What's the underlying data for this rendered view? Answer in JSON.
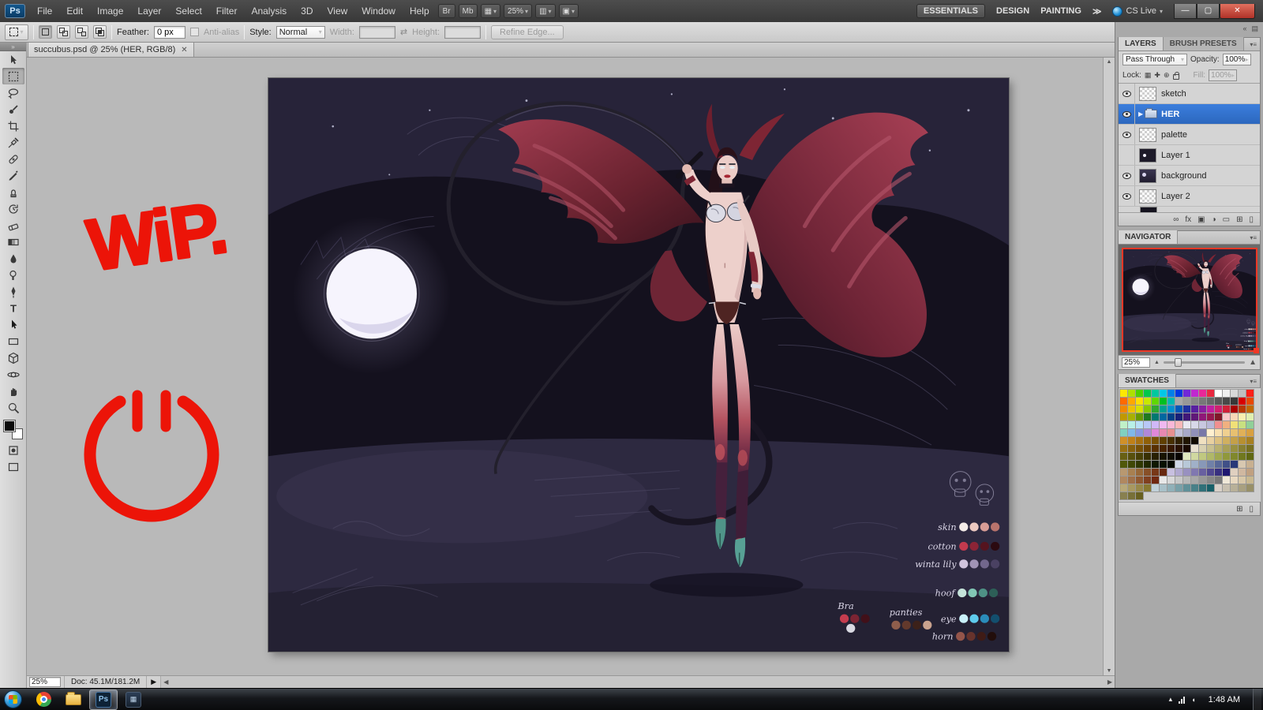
{
  "colors": {
    "selection_blue": "#3b7edd",
    "view_red": "#f03826",
    "wip_red": "#ec1408",
    "close_red": "#c0392b"
  },
  "menu_bar": {
    "logo": "Ps",
    "items": [
      "File",
      "Edit",
      "Image",
      "Layer",
      "Select",
      "Filter",
      "Analysis",
      "3D",
      "View",
      "Window",
      "Help"
    ],
    "bridge_button": "Br",
    "minibridge_button": "Mb",
    "zoom_level": "25%",
    "workspaces": [
      "ESSENTIALS",
      "DESIGN",
      "PAINTING"
    ],
    "cs_live": "CS Live"
  },
  "options_bar": {
    "feather_label": "Feather:",
    "feather_value": "0 px",
    "antialias_label": "Anti-alias",
    "style_label": "Style:",
    "style_value": "Normal",
    "width_label": "Width:",
    "height_label": "Height:",
    "refine_edge_label": "Refine Edge..."
  },
  "document": {
    "tab_title": "succubus.psd @ 25% (HER, RGB/8)",
    "status_zoom": "25%",
    "status_doc": "Doc: 45.1M/181.2M"
  },
  "artwork": {
    "wip_text": "WiP.",
    "palette": [
      {
        "label": "skin",
        "colors": [
          "#f4ece8",
          "#ecc9c1",
          "#d99d96",
          "#b8736c"
        ]
      },
      {
        "label": "cotton",
        "colors": [
          "#c23a4e",
          "#8c2436",
          "#55141f",
          "#2b0a10"
        ]
      },
      {
        "label": "winta lily",
        "colors": [
          "#cfc3dc",
          "#a093b5",
          "#72678c",
          "#4a4162"
        ]
      },
      {
        "label": "hoof",
        "colors": [
          "#c5e4da",
          "#82c7b5",
          "#4e9185",
          "#2d5f57"
        ]
      },
      {
        "label": "eye",
        "colors": [
          "#c9f1fa",
          "#5fcbec",
          "#2a8cba",
          "#134f6e"
        ]
      },
      {
        "label": "horn",
        "colors": [
          "#94554a",
          "#67332c",
          "#3f1b16",
          "#220e0b"
        ]
      },
      {
        "label": "Bra",
        "colors": [
          "#c43c4e",
          "#7c2433",
          "#411019",
          "#d9d9e2"
        ]
      },
      {
        "label": "panties",
        "colors": [
          "#8f5e4c",
          "#63392c",
          "#3c211a",
          "#c9a28e"
        ]
      }
    ]
  },
  "panels": {
    "layers": {
      "tab_label": "LAYERS",
      "brush_presets_label": "BRUSH PRESETS",
      "blend_mode": "Pass Through",
      "opacity_label": "Opacity:",
      "opacity_value": "100%",
      "lock_label": "Lock:",
      "fill_label": "Fill:",
      "fill_value": "100%",
      "fx_label": "fx",
      "items": [
        {
          "name": "sketch"
        },
        {
          "name": "HER"
        },
        {
          "name": "palette"
        },
        {
          "name": "Layer 1"
        },
        {
          "name": "background"
        },
        {
          "name": "Layer 2"
        }
      ]
    },
    "navigator": {
      "title": "NAVIGATOR",
      "zoom": "25%"
    },
    "swatches": {
      "title": "SWATCHES",
      "colors": [
        "#FFE800",
        "#AEE000",
        "#4CD000",
        "#00C84C",
        "#00C8A0",
        "#00C8E8",
        "#0080E8",
        "#0038E0",
        "#7028D8",
        "#C028D0",
        "#E82898",
        "#E82840",
        "#FFFFFF",
        "#F0F0F0",
        "#D8D8D8",
        "#C0C0C0",
        "#FF2018",
        "#FF6A00",
        "#FFA800",
        "#FFE000",
        "#C8E800",
        "#60D800",
        "#00C020",
        "#00B8B0",
        "#A8A8A8",
        "#989898",
        "#888888",
        "#787878",
        "#686868",
        "#585858",
        "#484848",
        "#383838",
        "#D80000",
        "#E84800",
        "#F08800",
        "#F0C000",
        "#D8E000",
        "#88C800",
        "#30A830",
        "#00A090",
        "#0090D0",
        "#0058B8",
        "#2030A0",
        "#5820A0",
        "#8820A0",
        "#C020A0",
        "#D02070",
        "#D02038",
        "#A80000",
        "#B83800",
        "#C06800",
        "#C09800",
        "#A8B000",
        "#689800",
        "#207820",
        "#007870",
        "#0068A0",
        "#004088",
        "#182078",
        "#401878",
        "#601878",
        "#901878",
        "#981850",
        "#801828",
        "#F8C8C8",
        "#F8D8B8",
        "#F8F0B0",
        "#E0F0B0",
        "#C0F0C8",
        "#B8F0E8",
        "#B8E0F8",
        "#B8C8F8",
        "#D0B8F8",
        "#F0B8F0",
        "#F8B8D8",
        "#F8B8B8",
        "#E8E8F0",
        "#D8D8E8",
        "#C8C8E0",
        "#B8B8D8",
        "#F09090",
        "#F0B080",
        "#F0E078",
        "#C8E080",
        "#90D098",
        "#80D0C0",
        "#80B8E8",
        "#8898E0",
        "#B088D8",
        "#E088D8",
        "#E888B0",
        "#E89090",
        "#C0C0D8",
        "#A8A8C8",
        "#9090B8",
        "#7878A8",
        "#FFF0D0",
        "#F8E0B0",
        "#F0D090",
        "#E8C070",
        "#E0B058",
        "#D8A040",
        "#D09028",
        "#C08018",
        "#A87010",
        "#906008",
        "#785004",
        "#604002",
        "#483001",
        "#302000",
        "#201400",
        "#100A00",
        "#F0E0C0",
        "#E8D0A0",
        "#DCC080",
        "#D0B060",
        "#C4A048",
        "#B89030",
        "#A88020",
        "#987014",
        "#88600C",
        "#785006",
        "#684003",
        "#583001",
        "#482400",
        "#381800",
        "#281000",
        "#180800",
        "#E8E0D0",
        "#D8D0B0",
        "#C8C090",
        "#B8B070",
        "#A8A058",
        "#989040",
        "#888030",
        "#787020",
        "#686014",
        "#58500C",
        "#484006",
        "#383003",
        "#282001",
        "#181400",
        "#100C00",
        "#080400",
        "#E0E8C0",
        "#D0D8A0",
        "#C0C880",
        "#B0B868",
        "#A0A850",
        "#90983C",
        "#80882C",
        "#70781E",
        "#606812",
        "#50580A",
        "#404804",
        "#303801",
        "#202800",
        "#101800",
        "#081000",
        "#040800",
        "#D0D8E8",
        "#B8C8D8",
        "#A0B0C8",
        "#8898B8",
        "#7080A8",
        "#586898",
        "#405088",
        "#283878",
        "#D8C8B0",
        "#C8B090",
        "#B89870",
        "#A88050",
        "#986838",
        "#885028",
        "#783818",
        "#682810",
        "#C8C0E0",
        "#B0A8D0",
        "#9890C0",
        "#8078B0",
        "#6860A0",
        "#504890",
        "#383080",
        "#201870",
        "#E0D0C0",
        "#D0B8A0",
        "#C0A080",
        "#B08860",
        "#A07048",
        "#905830",
        "#804020",
        "#702810",
        "#E8E8E8",
        "#D8D8D8",
        "#C8C8C8",
        "#B8B8B8",
        "#A8A8A8",
        "#989898",
        "#888888",
        "#787878",
        "#F0E8D8",
        "#E8D8C0",
        "#D8C8A8",
        "#C8B890",
        "#B8A878",
        "#A89860",
        "#988848",
        "#887830",
        "#C0D0D8",
        "#A8C0C8",
        "#90B0B8",
        "#78A0A8",
        "#609098",
        "#488088",
        "#307078",
        "#186068",
        "#D8D0C8",
        "#C8C0B0",
        "#B8B098",
        "#A8A080",
        "#989068",
        "#888050",
        "#787038",
        "#686020"
      ]
    }
  },
  "taskbar": {
    "time": "1:48 AM"
  },
  "icons": {
    "type_tool": "T"
  }
}
